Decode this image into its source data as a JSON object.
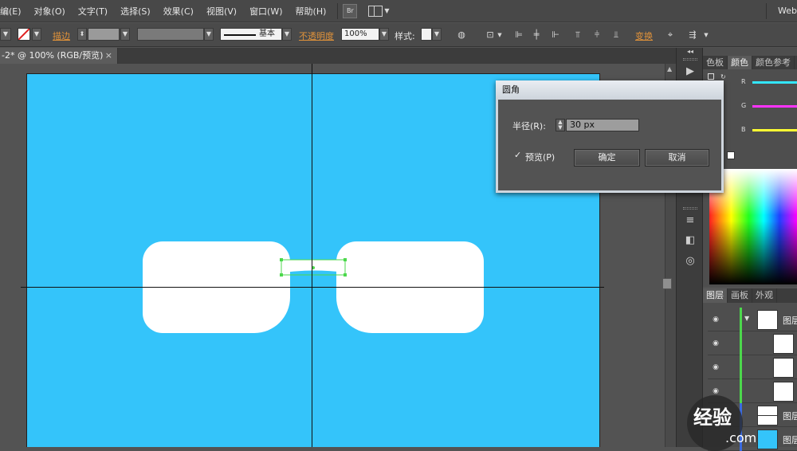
{
  "menubar": {
    "items": [
      "编(E)",
      "对象(O)",
      "文字(T)",
      "选择(S)",
      "效果(C)",
      "视图(V)",
      "窗口(W)",
      "帮助(H)"
    ],
    "br_label": "Br",
    "workspace": "Web"
  },
  "controlbar": {
    "stroke_label": "描边",
    "stroke_style": "基本",
    "opacity_label": "不透明度",
    "opacity_value": "100%",
    "style_label": "样式:",
    "transform_label": "变换"
  },
  "document": {
    "tab_title": "-2* @ 100% (RGB/预览)",
    "close_glyph": "×"
  },
  "dialog": {
    "title": "圆角",
    "radius_label": "半径(R):",
    "radius_value": "30 px",
    "preview_label": "预览(P)",
    "preview_checked": true,
    "ok_label": "确定",
    "cancel_label": "取消"
  },
  "color_panel": {
    "tabs": [
      "色板",
      "颜色",
      "颜色参考"
    ],
    "active_tab": "颜色",
    "sliders": [
      {
        "label": "R",
        "color": "#33e6ff"
      },
      {
        "label": "G",
        "color": "#ff33ff"
      },
      {
        "label": "B",
        "color": "#ffff33"
      }
    ]
  },
  "layers_panel": {
    "tabs": [
      "图层",
      "画板",
      "外观"
    ],
    "active_tab": "图层",
    "rows": [
      {
        "name": "图层",
        "kind": "layer"
      },
      {
        "name": "",
        "kind": "path"
      },
      {
        "name": "",
        "kind": "path"
      },
      {
        "name": "",
        "kind": "path"
      },
      {
        "name": "图层",
        "kind": "layer"
      },
      {
        "name": "图层",
        "kind": "layer"
      }
    ]
  },
  "watermark": {
    "text": "经验",
    "sub": ".com"
  },
  "colors": {
    "artboard": "#34c4fa",
    "shape": "#ffffff",
    "selection": "#4cd84c",
    "panel_bg": "#535353",
    "accent": "#e0923a"
  }
}
